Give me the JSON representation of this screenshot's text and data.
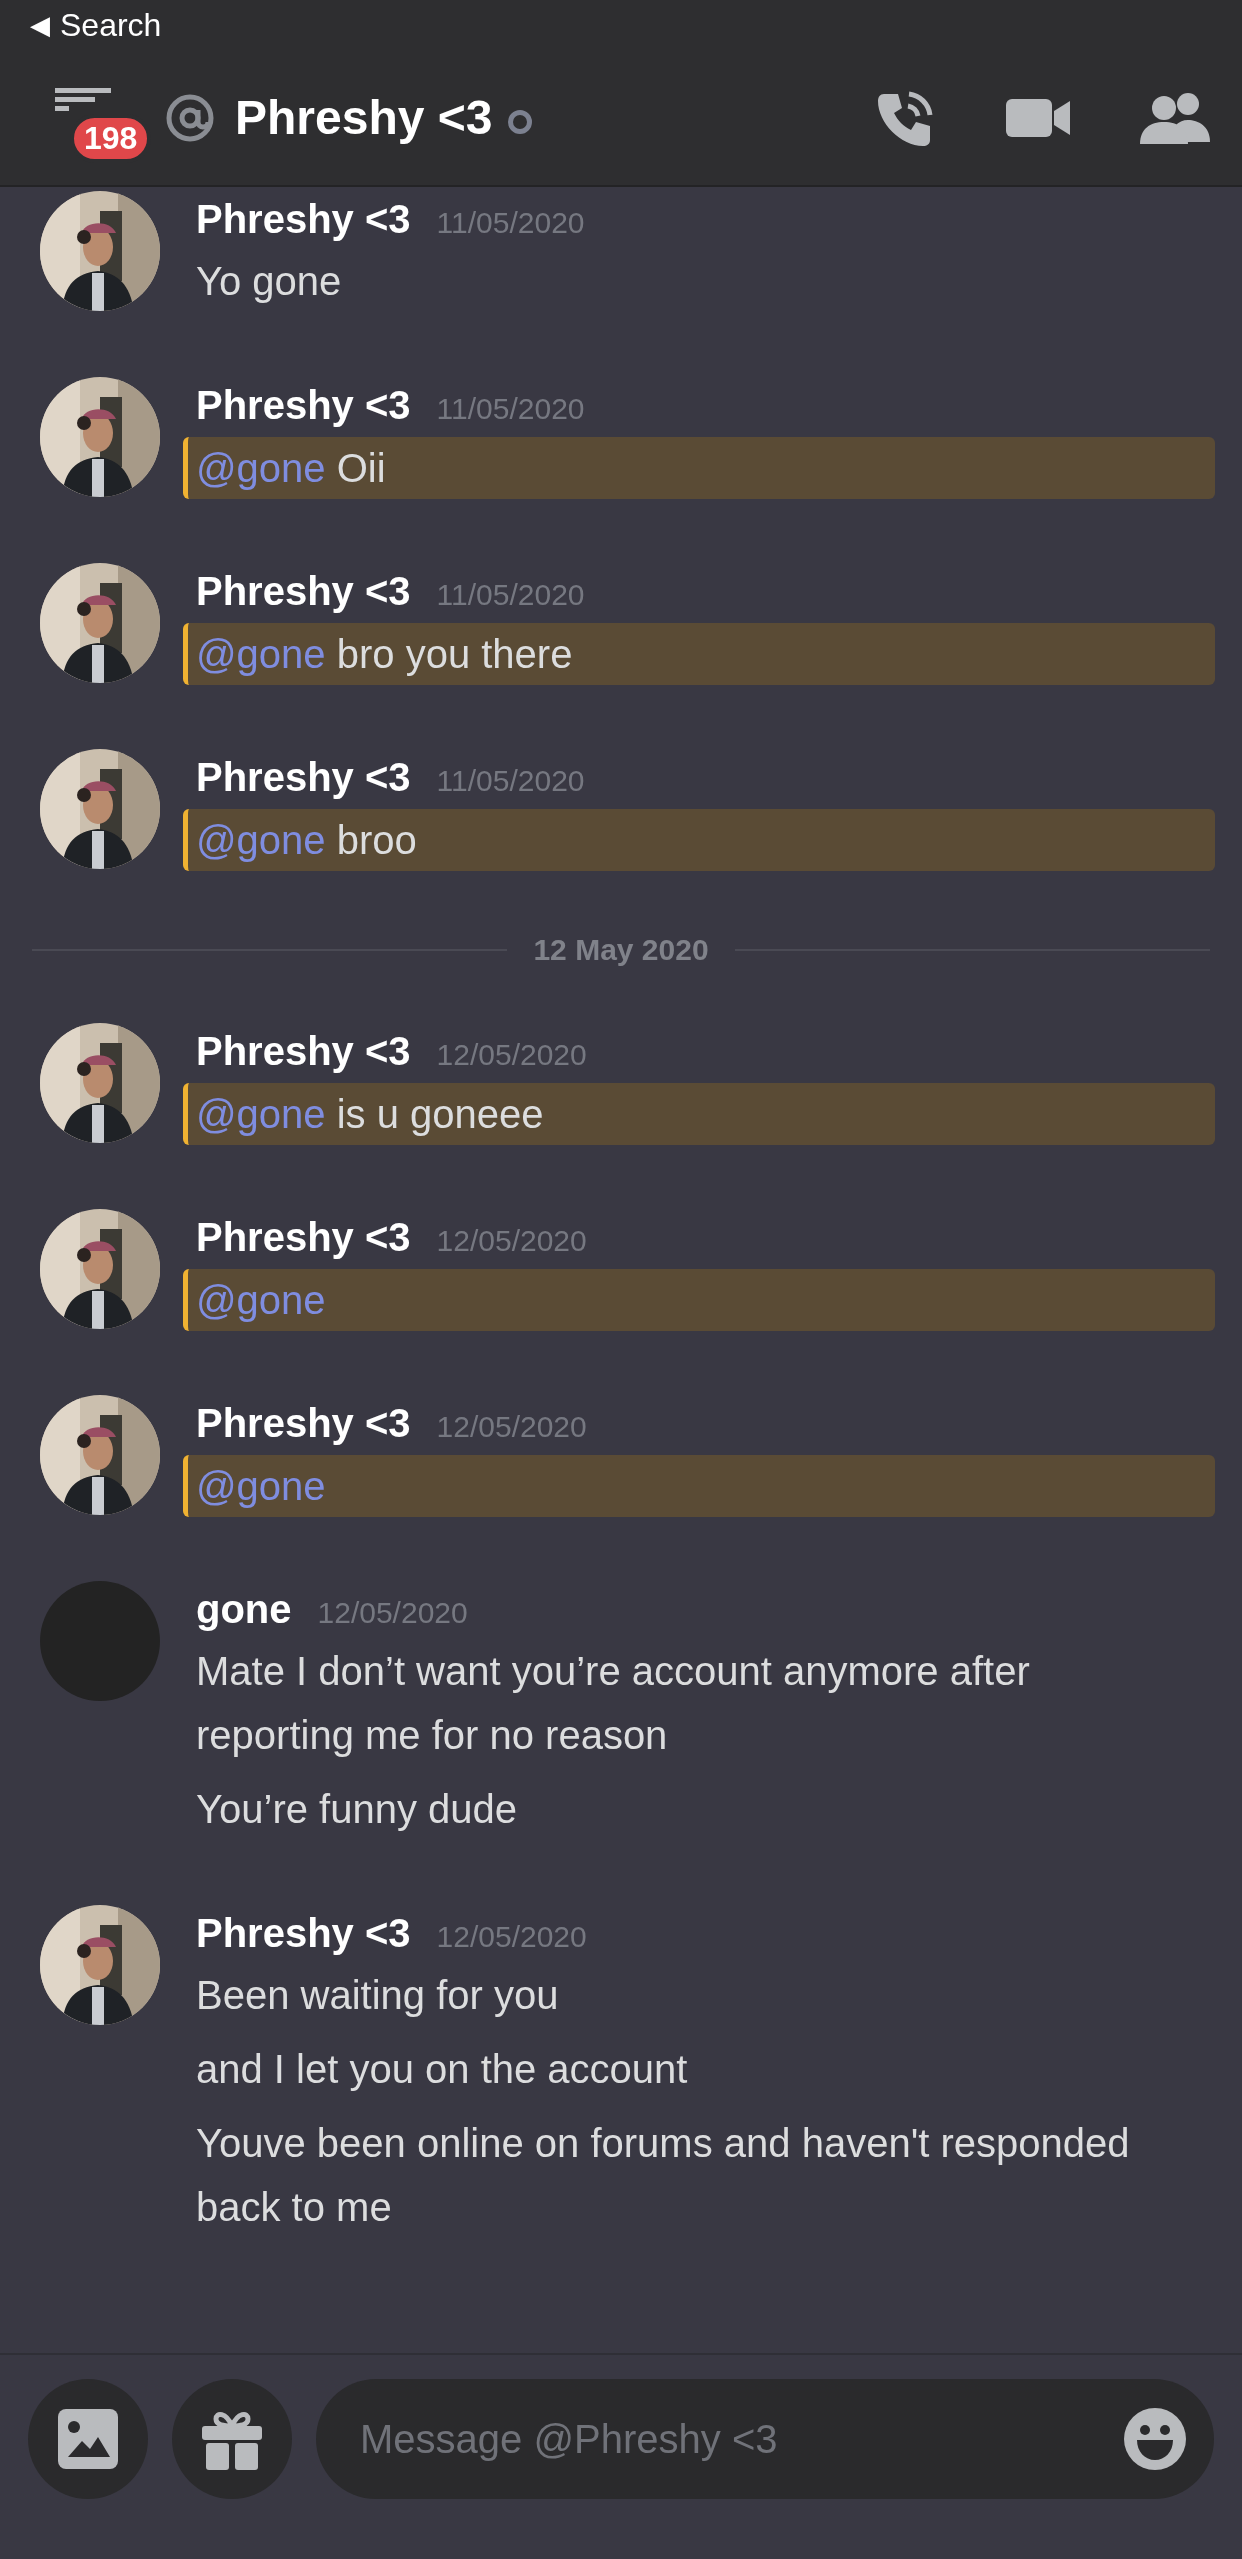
{
  "status_bar": {
    "back_arrow": "◀",
    "back_label": "Search"
  },
  "header": {
    "badge": "198",
    "title": "Phreshy <3",
    "online": false
  },
  "items": [
    {
      "kind": "message",
      "author": "Phreshy <3",
      "timestamp": "11/05/2020",
      "has_photo": true,
      "highlighted": false,
      "lines": [
        "Yo gone"
      ]
    },
    {
      "kind": "message",
      "author": "Phreshy <3",
      "timestamp": "11/05/2020",
      "has_photo": true,
      "highlighted": true,
      "mention": "@gone",
      "lines": [
        "Oii"
      ]
    },
    {
      "kind": "message",
      "author": "Phreshy <3",
      "timestamp": "11/05/2020",
      "has_photo": true,
      "highlighted": true,
      "mention": "@gone",
      "lines": [
        "bro you there"
      ]
    },
    {
      "kind": "message",
      "author": "Phreshy <3",
      "timestamp": "11/05/2020",
      "has_photo": true,
      "highlighted": true,
      "mention": "@gone",
      "lines": [
        "broo"
      ]
    },
    {
      "kind": "divider",
      "label": "12 May 2020"
    },
    {
      "kind": "message",
      "author": "Phreshy <3",
      "timestamp": "12/05/2020",
      "has_photo": true,
      "highlighted": true,
      "mention": "@gone",
      "lines": [
        "is u goneee"
      ]
    },
    {
      "kind": "message",
      "author": "Phreshy <3",
      "timestamp": "12/05/2020",
      "has_photo": true,
      "highlighted": true,
      "mention": "@gone"
    },
    {
      "kind": "message",
      "author": "Phreshy <3",
      "timestamp": "12/05/2020",
      "has_photo": true,
      "highlighted": true,
      "mention": "@gone"
    },
    {
      "kind": "message",
      "author": "gone",
      "timestamp": "12/05/2020",
      "has_photo": false,
      "highlighted": false,
      "lines": [
        "Mate I don’t want you’re account anymore after reporting me for no reason",
        "You’re funny dude"
      ]
    },
    {
      "kind": "message",
      "author": "Phreshy <3",
      "timestamp": "12/05/2020",
      "has_photo": true,
      "highlighted": false,
      "lines": [
        "Been waiting for you",
        "and I let you on the account",
        "Youve been online on forums and haven't responded back to me"
      ]
    }
  ],
  "composer": {
    "placeholder": "Message @Phreshy <3"
  }
}
